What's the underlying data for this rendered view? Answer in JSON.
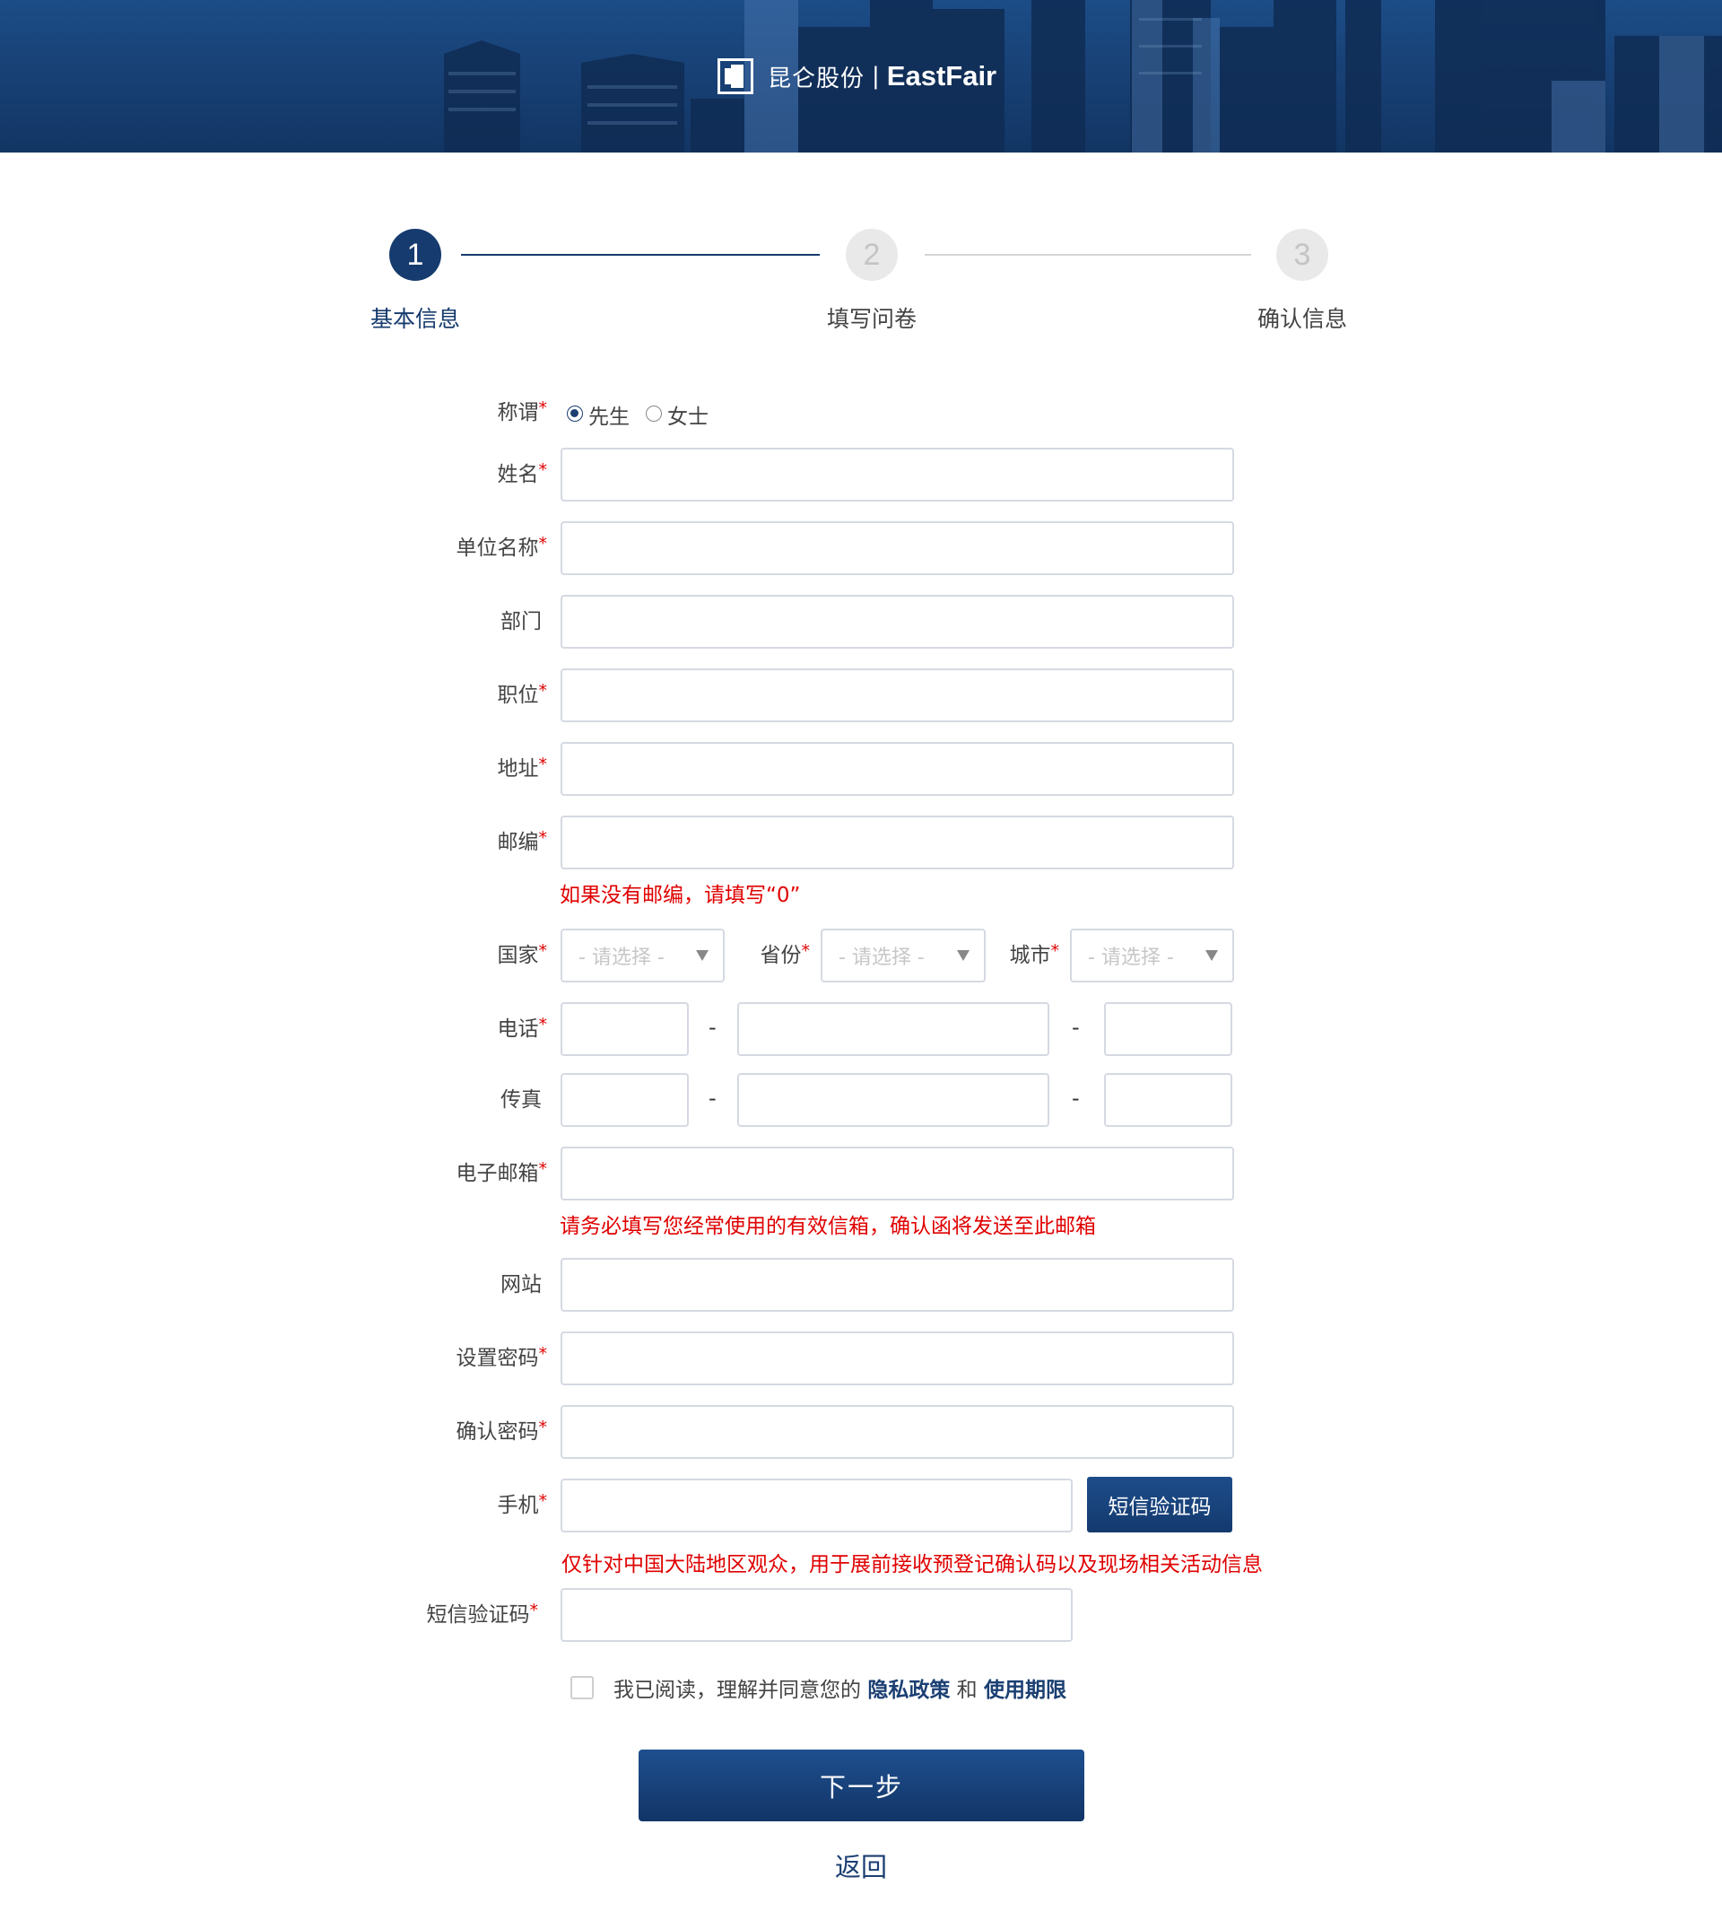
{
  "header": {
    "logo_cn": "昆仑股份",
    "logo_sep": "|",
    "logo_en": "EastFair"
  },
  "steps": [
    {
      "num": "1",
      "label": "基本信息",
      "state": "active"
    },
    {
      "num": "2",
      "label": "填写问卷",
      "state": "inactive"
    },
    {
      "num": "3",
      "label": "确认信息",
      "state": "inactive"
    }
  ],
  "required_mark": "*",
  "form": {
    "title_label": "称谓",
    "title_options": [
      "先生",
      "女士"
    ],
    "title_selected": "先生",
    "name_label": "姓名",
    "company_label": "单位名称",
    "department_label": "部门",
    "position_label": "职位",
    "address_label": "地址",
    "zip_label": "邮编",
    "zip_hint": "如果没有邮编，请填写“0”",
    "country_label": "国家",
    "province_label": "省份",
    "city_label": "城市",
    "select_placeholder": "- 请选择 -",
    "phone_label": "电话",
    "fax_label": "传真",
    "dash": "-",
    "email_label": "电子邮箱",
    "email_hint": "请务必填写您经常使用的有效信箱，确认函将发送至此邮箱",
    "website_label": "网站",
    "password_label": "设置密码",
    "confirm_password_label": "确认密码",
    "mobile_label": "手机",
    "sms_button": "短信验证码",
    "mobile_hint": "仅针对中国大陆地区观众，用于展前接收预登记确认码以及现场相关活动信息",
    "sms_code_label": "短信验证码",
    "agree_text": "我已阅读，理解并同意您的",
    "privacy_link": "隐私政策",
    "and_text": "和",
    "terms_link": "使用期限",
    "next_button": "下一步",
    "back_link": "返回"
  },
  "colors": {
    "primary": "#163b6e",
    "required": "#e00000",
    "border": "#d5d9e2"
  }
}
